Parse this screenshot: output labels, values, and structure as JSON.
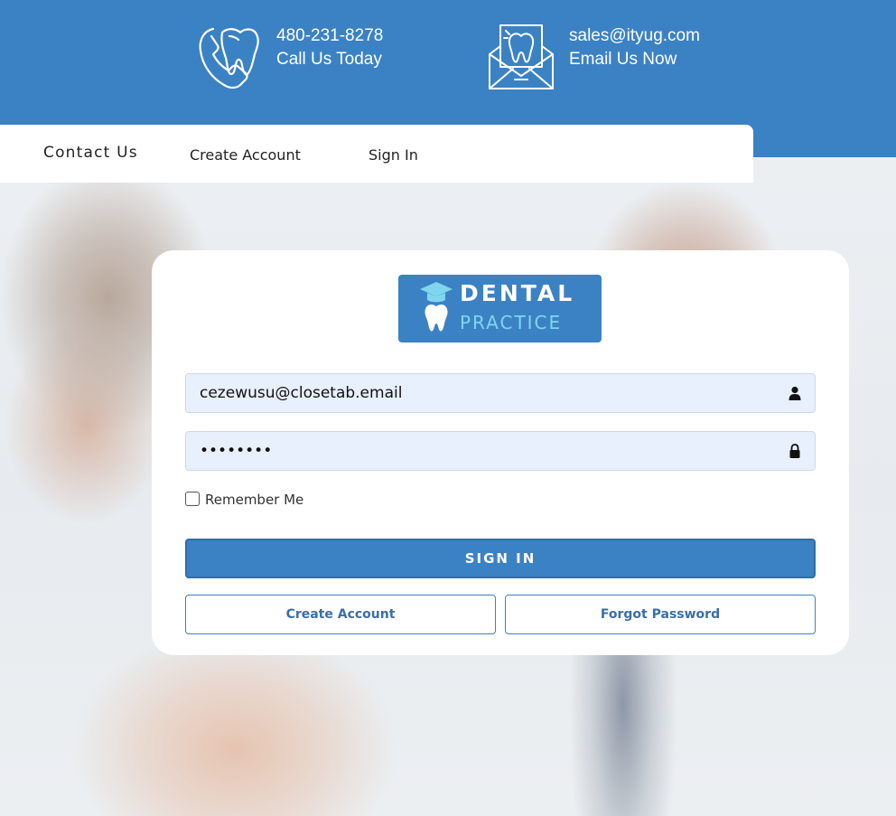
{
  "header": {
    "phone": {
      "number": "480-231-8278",
      "caption": "Call Us Today",
      "icon": "tooth-phone-icon"
    },
    "email": {
      "address": "sales@ityug.com",
      "caption": "Email Us Now",
      "icon": "tooth-envelope-icon"
    }
  },
  "nav": {
    "items": [
      {
        "label": "Contact Us"
      },
      {
        "label": "Create Account"
      },
      {
        "label": "Sign In"
      }
    ]
  },
  "login": {
    "logo": {
      "line1": "DENTAL",
      "line2": "PRACTICE"
    },
    "email_value": "cezewusu@closetab.email",
    "password_value": "••••••••",
    "remember_label": "Remember Me",
    "remember_checked": false,
    "signin_label": "SIGN IN",
    "create_label": "Create Account",
    "forgot_label": "Forgot Password"
  },
  "colors": {
    "brand": "#3b82c4",
    "field_bg": "#e8f0fd"
  }
}
